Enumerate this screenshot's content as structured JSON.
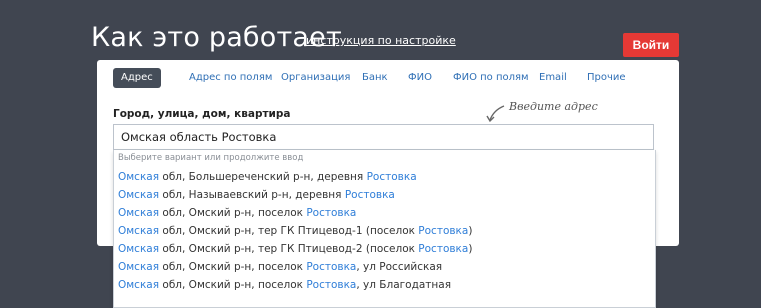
{
  "header": {
    "title": "Как это работает",
    "instructions_link": "инструкция по настройке",
    "login_button": "Войти"
  },
  "colors": {
    "background": "#404550",
    "login_button": "#e53935",
    "active_tab": "#454d59",
    "link": "#2f6fb5",
    "highlight": "#2f7ed8"
  },
  "tabs": [
    {
      "label": "Адрес",
      "active": true
    },
    {
      "label": "Адрес по полям",
      "active": false
    },
    {
      "label": "Организация",
      "active": false
    },
    {
      "label": "Банк",
      "active": false
    },
    {
      "label": "ФИО",
      "active": false
    },
    {
      "label": "ФИО по полям",
      "active": false
    },
    {
      "label": "Email",
      "active": false
    },
    {
      "label": "Прочие",
      "active": false
    }
  ],
  "form": {
    "field_label": "Город, улица, дом, квартира",
    "hint": "Введите адрес",
    "hint_icon": "curved-arrow-icon",
    "input_value": "Омская область Ростовка"
  },
  "suggestions": {
    "hint": "Выберите вариант или продолжите ввод",
    "items": [
      {
        "p1": "Омская",
        "mid": " обл, Большереченский р-н, деревня ",
        "p2": "Ростовка",
        "tail": ""
      },
      {
        "p1": "Омская",
        "mid": " обл, Называевский р-н, деревня ",
        "p2": "Ростовка",
        "tail": ""
      },
      {
        "p1": "Омская",
        "mid": " обл, Омский р-н, поселок ",
        "p2": "Ростовка",
        "tail": ""
      },
      {
        "p1": "Омская",
        "mid": " обл, Омский р-н, тер ГК Птицевод-1 (поселок ",
        "p2": "Ростовка",
        "tail": ")"
      },
      {
        "p1": "Омская",
        "mid": " обл, Омский р-н, тер ГК Птицевод-2 (поселок ",
        "p2": "Ростовка",
        "tail": ")"
      },
      {
        "p1": "Омская",
        "mid": " обл, Омский р-н, поселок ",
        "p2": "Ростовка",
        "tail": ", ул Российская"
      },
      {
        "p1": "Омская",
        "mid": " обл, Омский р-н, поселок ",
        "p2": "Ростовка",
        "tail": ", ул Благодатная"
      }
    ]
  }
}
